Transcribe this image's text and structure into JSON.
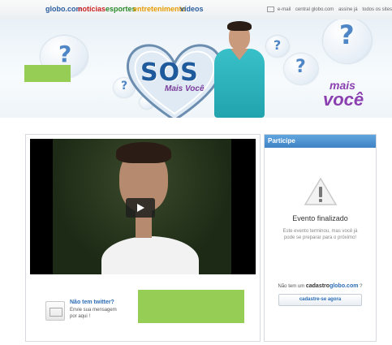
{
  "header": {
    "logo": "globo.com",
    "nav": [
      {
        "label": "notícias",
        "color": "#cc2222"
      },
      {
        "label": "esportes",
        "color": "#2a8a2a"
      },
      {
        "label": "entretenimento",
        "color": "#e79b00"
      },
      {
        "label": "vídeos",
        "color": "#2b5d9e"
      }
    ],
    "links": [
      "e-mail",
      "central globo.com",
      "assine já",
      "todos os sites"
    ]
  },
  "banner": {
    "title": "SOS",
    "subtitle": "Mais Você",
    "brand_top": "mais",
    "brand_bottom": "você"
  },
  "video": {
    "play_icon": "play-icon"
  },
  "twitter": {
    "heading": "Não tem twitter?",
    "line1": "Envie sua mensagem",
    "line2": "por aqui !"
  },
  "participe": {
    "header": "Participe",
    "status": "Evento finalizado",
    "desc1": "Este evento terminou, mas você já",
    "desc2": "pode se preparar para o próximo!",
    "signup_prefix": "Não tem um",
    "signup_brand1": "cadastro",
    "signup_brand2": "globo.com",
    "signup_suffix": "?",
    "button": "cadastre-se agora"
  }
}
